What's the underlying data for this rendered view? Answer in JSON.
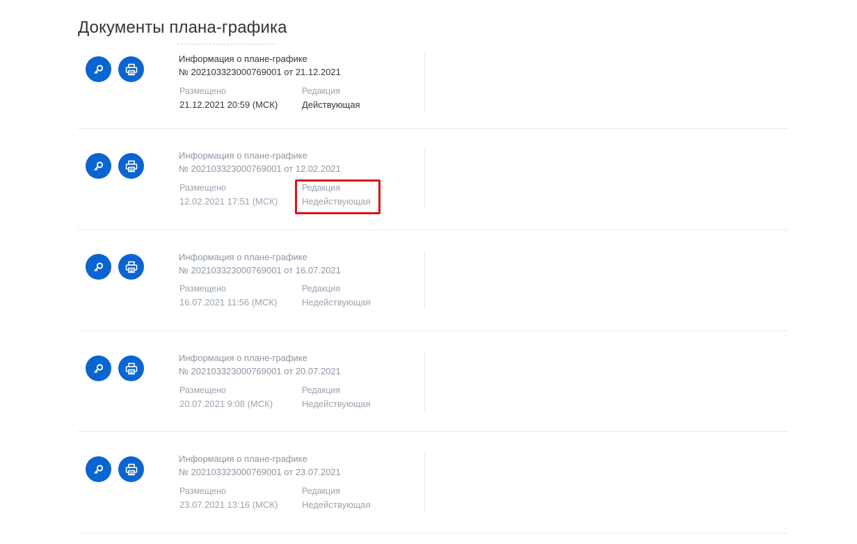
{
  "page": {
    "title": "Документы плана-графика"
  },
  "documents": [
    {
      "title_line1": "Информация о плане-графике",
      "title_line2": "№ 202103323000769001 от 21.12.2021",
      "placed_label": "Размещено",
      "placed_value": "21.12.2021 20:59 (МСК)",
      "edition_label": "Редакция",
      "edition_value": "Действующая",
      "active": true
    },
    {
      "title_line1": "Информация о плане-графике",
      "title_line2": "№ 202103323000769001 от 12.02.2021",
      "placed_label": "Размещено",
      "placed_value": "12.02.2021 17:51 (МСК)",
      "edition_label": "Редакция",
      "edition_value": "Недействующая",
      "active": false
    },
    {
      "title_line1": "Информация о плане-графике",
      "title_line2": "№ 202103323000769001 от 16.07.2021",
      "placed_label": "Размещено",
      "placed_value": "16.07.2021 11:56 (МСК)",
      "edition_label": "Редакция",
      "edition_value": "Недействующая",
      "active": false
    },
    {
      "title_line1": "Информация о плане-графике",
      "title_line2": "№ 202103323000769001 от 20.07.2021",
      "placed_label": "Размещено",
      "placed_value": "20.07.2021 9:08 (МСК)",
      "edition_label": "Редакция",
      "edition_value": "Недействующая",
      "active": false
    },
    {
      "title_line1": "Информация о плане-графике",
      "title_line2": "№ 202103323000769001 от 23.07.2021",
      "placed_label": "Размещено",
      "placed_value": "23.07.2021 13:16 (МСК)",
      "edition_label": "Редакция",
      "edition_value": "Недействующая",
      "active": false
    }
  ],
  "icons": {
    "view": "magnifier-key-icon",
    "print": "printer-icon"
  },
  "colors": {
    "accent": "#0a64d2",
    "highlight": "#d7141a",
    "text_active": "#32343a",
    "text_inactive": "#8d96a3"
  }
}
